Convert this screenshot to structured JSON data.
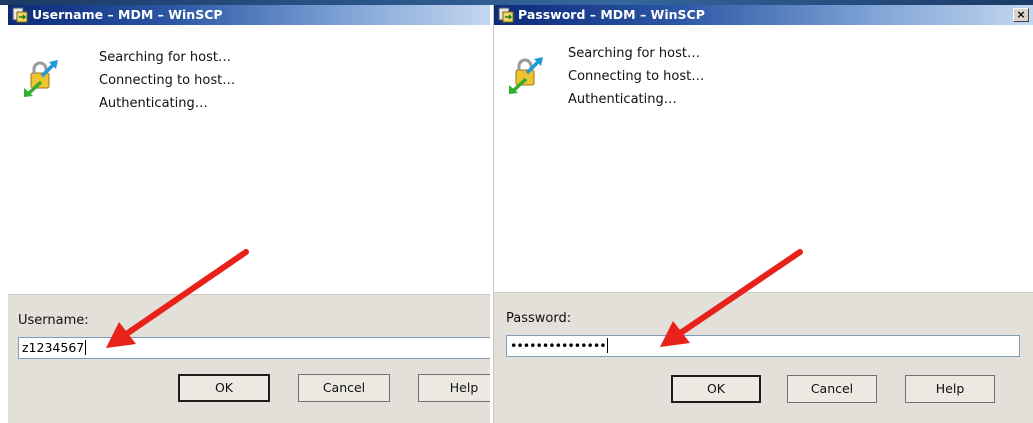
{
  "dialogs": [
    {
      "title": "Username – MDM – WinSCP",
      "status": [
        "Searching for host…",
        "Connecting to host…",
        "Authenticating…"
      ],
      "field_label": "Username:",
      "field_value": "z1234567",
      "buttons": {
        "ok": "OK",
        "cancel": "Cancel",
        "help": "Help"
      }
    },
    {
      "title": "Password – MDM – WinSCP",
      "close_glyph": "×",
      "status": [
        "Searching for host…",
        "Connecting to host…",
        "Authenticating…"
      ],
      "field_label": "Password:",
      "field_value": "•••••••••••••••",
      "buttons": {
        "ok": "OK",
        "cancel": "Cancel",
        "help": "Help"
      }
    }
  ],
  "icons": {
    "app": "winscp-app-icon",
    "progress": "lock-transfer-icon",
    "annotation": "red-arrow-icon"
  },
  "colors": {
    "titlebar_start": "#0b2a7a",
    "titlebar_end": "#c4d7f0",
    "panel": "#e3e0d9",
    "annotation_arrow": "#e8211b"
  }
}
